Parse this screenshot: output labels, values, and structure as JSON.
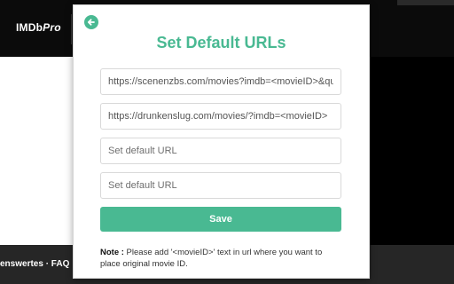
{
  "background": {
    "logo_main": "IMDb",
    "logo_pro": "Pro",
    "footer_text": "enswertes  ·  FAQ"
  },
  "popup": {
    "title": "Set Default URLs",
    "back_icon": "arrow-left-icon",
    "fields": [
      {
        "value": "https://scenenzbs.com/movies?imdb=<movieID>&quality",
        "placeholder": "Set default URL"
      },
      {
        "value": "https://drunkenslug.com/movies/?imdb=<movieID>",
        "placeholder": "Set default URL"
      },
      {
        "value": "",
        "placeholder": "Set default URL"
      },
      {
        "value": "",
        "placeholder": "Set default URL"
      }
    ],
    "save_label": "Save",
    "note_label": "Note :",
    "note_text": " Please add '<movieID>' text in url where you want to place original movie ID."
  },
  "colors": {
    "accent": "#49b992"
  }
}
